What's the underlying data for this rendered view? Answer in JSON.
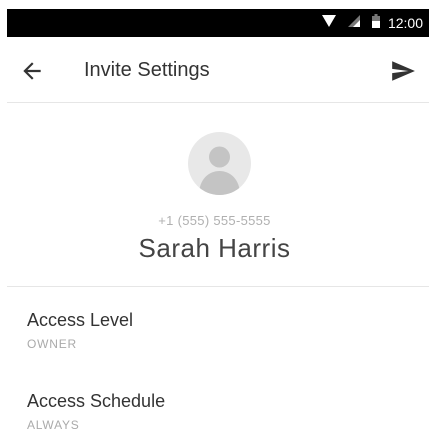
{
  "status_bar": {
    "time": "12:00",
    "icons": [
      "wifi-icon",
      "signal-icon",
      "battery-icon"
    ]
  },
  "toolbar": {
    "title": "Invite Settings",
    "back_icon": "arrow-back-icon",
    "send_icon": "send-icon"
  },
  "contact": {
    "avatar_icon": "person-icon",
    "phone": "+1 (555) 555-5555",
    "name": "Sarah Harris"
  },
  "settings": [
    {
      "label": "Access Level",
      "value": "OWNER"
    },
    {
      "label": "Access Schedule",
      "value": "ALWAYS"
    }
  ],
  "colors": {
    "status_bar_bg": "#000000",
    "text_primary": "#333333",
    "text_secondary": "#aaaaaa",
    "avatar_bg": "#e8e8e8",
    "avatar_fg": "#c4c4c4"
  }
}
